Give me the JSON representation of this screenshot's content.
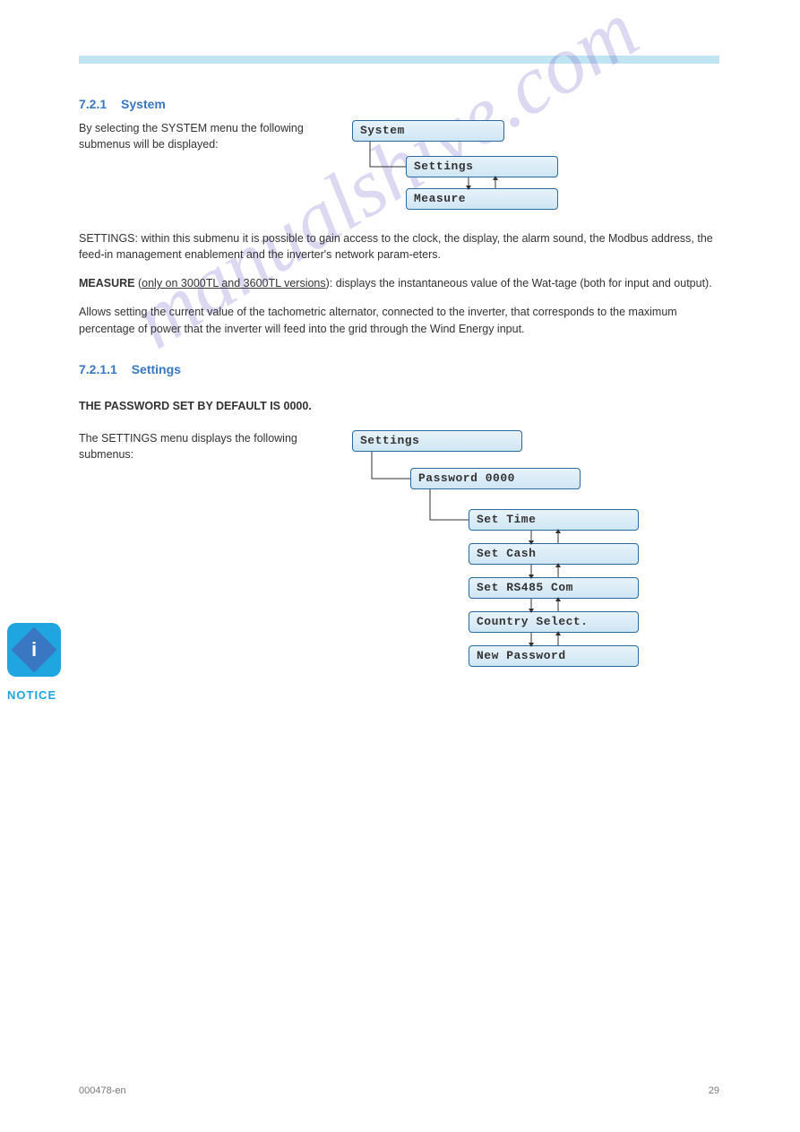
{
  "section_721": {
    "number": "7.2.1",
    "title": "System",
    "text_1": "By selecting the SYSTEM menu the following submenus will be displayed:",
    "diagram": {
      "box_system": "System",
      "box_settings": "Settings",
      "box_measure": "Measure"
    },
    "text_2": "SETTINGS: within this submenu it is possible to gain access to the clock, the display, the alarm sound, the Modbus address, the feed-in management enablement and the inverter's network param-eters.",
    "text_3_strong": "MEASURE",
    "text_3_rest": ": displays the instantaneous value of the Wat-tage (both for input and output).",
    "text_3_underline": "only on 3000TL and 3600TL versions",
    "text_4": "Allows setting the current value of the tachometric alternator, connected to the inverter, that corresponds to the maximum percentage of power that the inverter will feed into the grid through the Wind Energy input."
  },
  "section_7211": {
    "number": "7.2.1.1",
    "title": "Settings",
    "notice_label": "NOTICE",
    "notice_text": "THE PASSWORD SET BY DEFAULT IS 0000.",
    "text_1": "The SETTINGS menu displays the following submenus:",
    "diagram": {
      "box_settings": "Settings",
      "box_password": "Password 0000",
      "box_set_time": "Set Time",
      "box_set_cash": "Set Cash",
      "box_set_rs485": "Set RS485 Com",
      "box_country": "Country Select.",
      "box_new_password": "New Password"
    }
  },
  "footer": {
    "code": "000478-en",
    "page": "29"
  },
  "watermark": "manualshive.com"
}
